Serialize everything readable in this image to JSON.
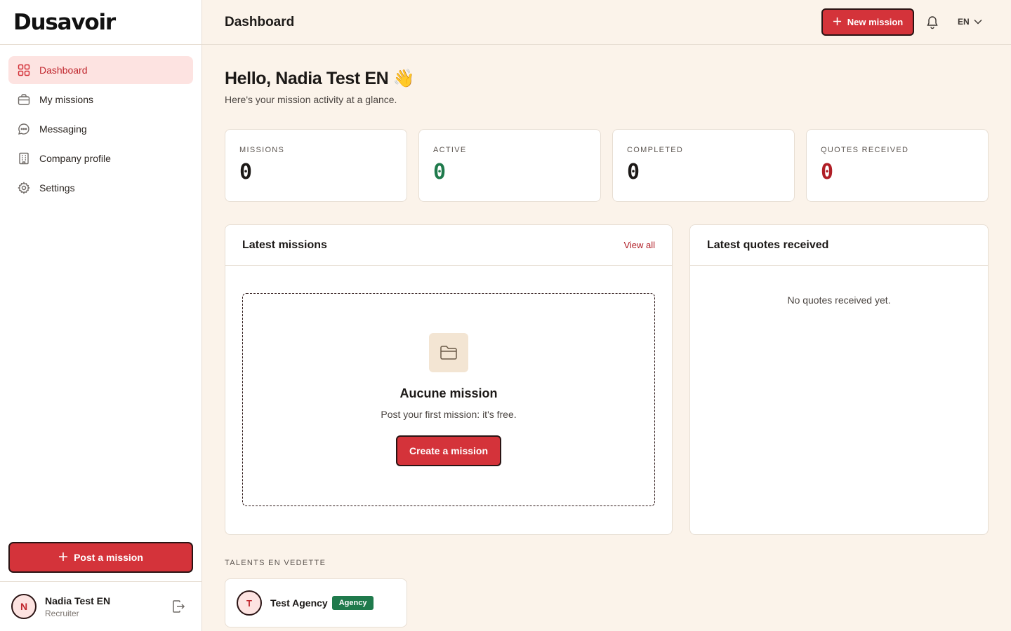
{
  "app": {
    "brand": "Dusavoir"
  },
  "sidebar": {
    "items": [
      {
        "label": "Dashboard",
        "icon": "grid-icon",
        "active": true
      },
      {
        "label": "My missions",
        "icon": "briefcase-icon",
        "active": false
      },
      {
        "label": "Messaging",
        "icon": "chat-icon",
        "active": false
      },
      {
        "label": "Company profile",
        "icon": "building-icon",
        "active": false
      },
      {
        "label": "Settings",
        "icon": "gear-icon",
        "active": false
      }
    ],
    "post_button": "Post a mission",
    "user": {
      "initial": "N",
      "name": "Nadia Test EN",
      "role": "Recruiter"
    }
  },
  "header": {
    "title": "Dashboard",
    "new_mission": "New mission",
    "language": "EN"
  },
  "greeting": {
    "title": "Hello, Nadia Test EN",
    "emoji": "👋",
    "subtitle": "Here's your mission activity at a glance."
  },
  "stats": [
    {
      "label": "MISSIONS",
      "value": "0",
      "color": "#1c1917"
    },
    {
      "label": "ACTIVE",
      "value": "0",
      "color": "#1f7a4c"
    },
    {
      "label": "COMPLETED",
      "value": "0",
      "color": "#1c1917"
    },
    {
      "label": "QUOTES RECEIVED",
      "value": "0",
      "color": "#b01e26"
    }
  ],
  "latest_missions": {
    "title": "Latest missions",
    "view_all": "View all",
    "empty_title": "Aucune mission",
    "empty_subtitle": "Post your first mission: it's free.",
    "create_button": "Create a mission"
  },
  "latest_quotes": {
    "title": "Latest quotes received",
    "empty": "No quotes received yet."
  },
  "talents": {
    "label": "TALENTS EN VEDETTE",
    "items": [
      {
        "initial": "T",
        "name": "Test Agency",
        "badge": "Agency"
      }
    ]
  },
  "colors": {
    "accent": "#d4333a",
    "background": "#fbf3ea",
    "active_nav": "#fde3e1",
    "success": "#1f7a4c"
  }
}
